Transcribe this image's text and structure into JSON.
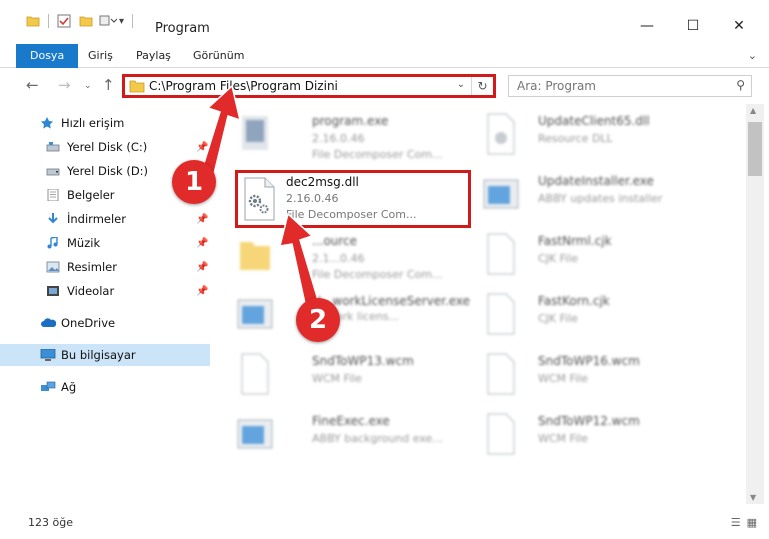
{
  "window": {
    "title": "Program",
    "min_label": "—",
    "max_label": "☐",
    "close_label": "✕"
  },
  "ribbon": {
    "tabs": [
      {
        "label": "Dosya",
        "active": true
      },
      {
        "label": "Giriş",
        "active": false
      },
      {
        "label": "Paylaş",
        "active": false
      },
      {
        "label": "Görünüm",
        "active": false
      }
    ],
    "expand_icon": "chevron-down-icon"
  },
  "address": {
    "path": "C:\\Program Files\\Program Dizini",
    "search_placeholder": "Ara: Program"
  },
  "navpane": {
    "items": [
      {
        "label": "Hızlı erişim",
        "icon": "star-icon",
        "pinned": false,
        "selected": false
      },
      {
        "label": "Yerel Disk (C:)",
        "icon": "drive-icon",
        "pinned": true,
        "selected": false
      },
      {
        "label": "Yerel Disk (D:)",
        "icon": "drive-icon",
        "pinned": true,
        "selected": false
      },
      {
        "label": "Belgeler",
        "icon": "documents-icon",
        "pinned": true,
        "selected": false
      },
      {
        "label": "İndirmeler",
        "icon": "download-icon",
        "pinned": true,
        "selected": false
      },
      {
        "label": "Müzik",
        "icon": "music-icon",
        "pinned": true,
        "selected": false
      },
      {
        "label": "Resimler",
        "icon": "pictures-icon",
        "pinned": true,
        "selected": false
      },
      {
        "label": "Videolar",
        "icon": "videos-icon",
        "pinned": true,
        "selected": false
      },
      {
        "label": "OneDrive",
        "icon": "cloud-icon",
        "pinned": false,
        "selected": false
      },
      {
        "label": "Bu bilgisayar",
        "icon": "computer-icon",
        "pinned": false,
        "selected": true
      },
      {
        "label": "Ağ",
        "icon": "network-icon",
        "pinned": false,
        "selected": false
      }
    ]
  },
  "files": {
    "left": [
      {
        "name": "program.exe",
        "meta1": "2.16.0.46",
        "meta2": "File Decomposer Com...",
        "blurred": true
      },
      {
        "name": "dec2msg.dll",
        "meta1": "2.16.0.46",
        "meta2": "File Decomposer Com...",
        "blurred": false
      },
      {
        "name": "...ource",
        "meta1": "2.1...0.46",
        "meta2": "File Decomposer Com...",
        "blurred": true
      },
      {
        "name": "N...workLicenseServer.exe",
        "meta1": "",
        "meta2": "...twork licens...",
        "blurred": true
      },
      {
        "name": "SndToWP13.wcm",
        "meta1": "WCM File",
        "meta2": "",
        "blurred": true
      },
      {
        "name": "FineExec.exe",
        "meta1": "ABBY background exe...",
        "meta2": "",
        "blurred": true
      }
    ],
    "right": [
      {
        "name": "UpdateClient65.dll",
        "meta1": "Resource DLL",
        "meta2": ""
      },
      {
        "name": "UpdateInstaller.exe",
        "meta1": "ABBY updates installer",
        "meta2": ""
      },
      {
        "name": "FastNrml.cjk",
        "meta1": "CJK File",
        "meta2": ""
      },
      {
        "name": "FastKorn.cjk",
        "meta1": "CJK File",
        "meta2": ""
      },
      {
        "name": "SndToWP16.wcm",
        "meta1": "WCM File",
        "meta2": ""
      },
      {
        "name": "SndToWP12.wcm",
        "meta1": "WCM File",
        "meta2": ""
      }
    ]
  },
  "status": {
    "count": "123 öğe"
  },
  "callouts": [
    {
      "label": "1"
    },
    {
      "label": "2"
    }
  ],
  "colors": {
    "accent": "#1979ca",
    "annotation": "#e12a2a",
    "selection": "#cce4f7"
  }
}
